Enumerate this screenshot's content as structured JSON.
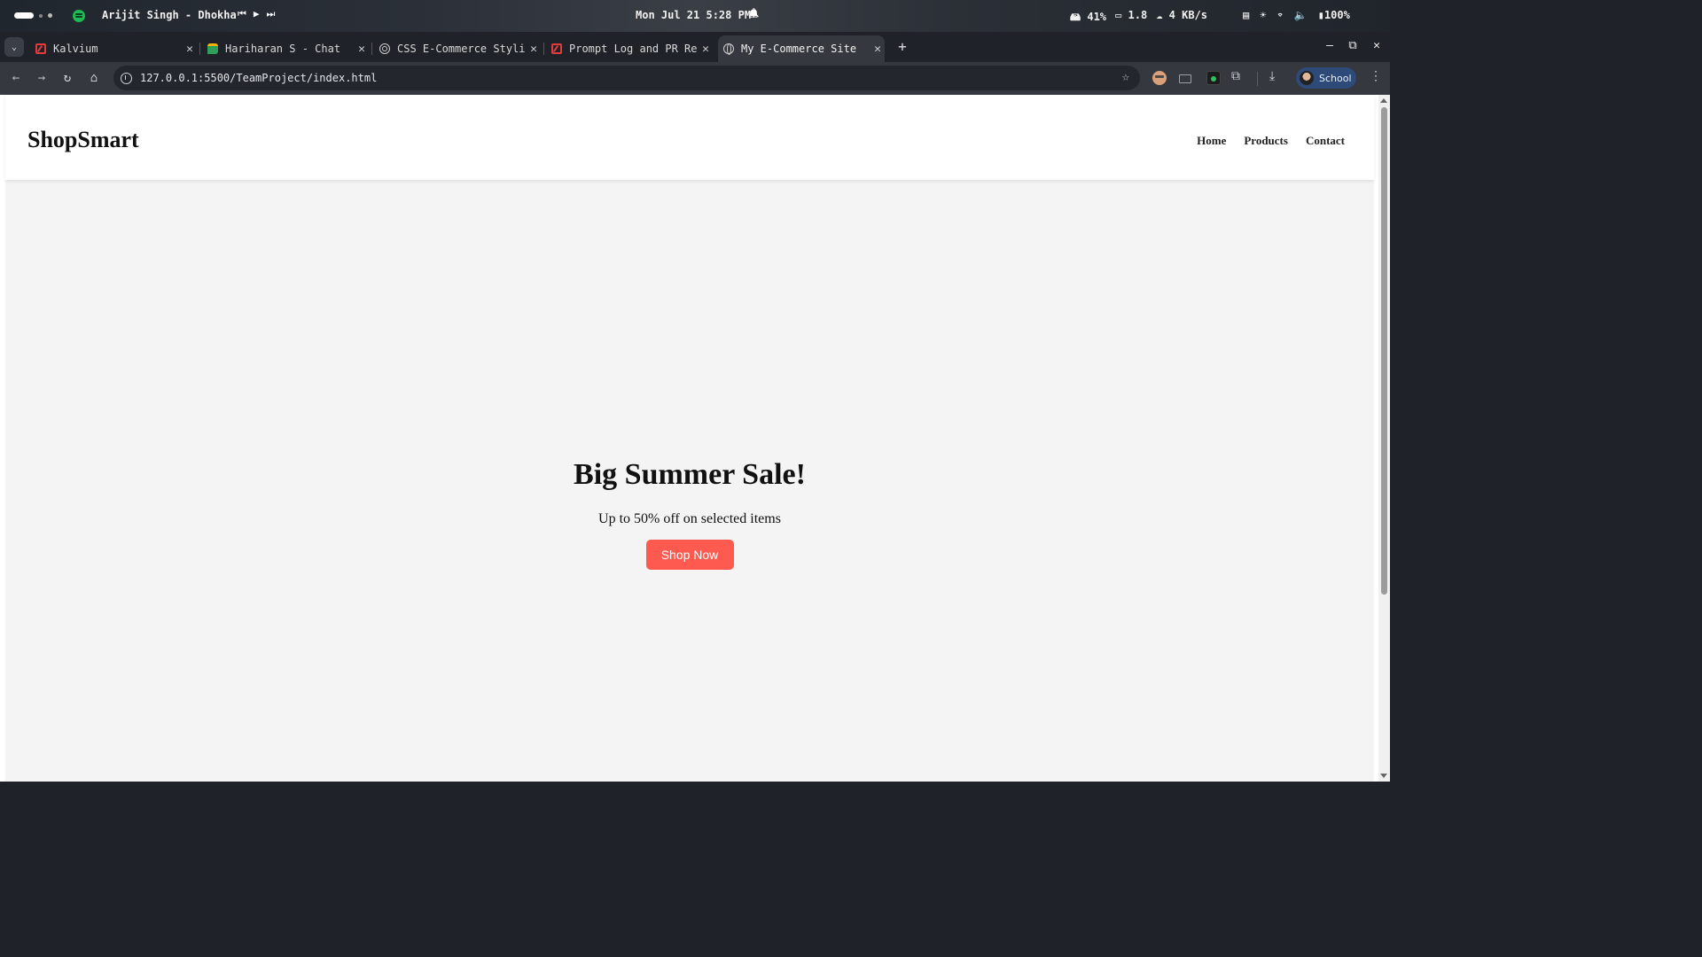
{
  "os": {
    "now_playing": "Arijit Singh - Dhokha",
    "media": {
      "prev": "⏮",
      "play": "▶",
      "next": "⏭"
    },
    "datetime": "Mon Jul 21   5:28 PM",
    "bell": "🔔",
    "stats": {
      "disk": "41%",
      "cpu": "1.8",
      "network": "4 KB/s"
    },
    "battery": "100%"
  },
  "tabs": [
    {
      "title": "Kalvium",
      "icon": "kalvium-icon"
    },
    {
      "title": "Hariharan S - Chat",
      "icon": "chat-icon"
    },
    {
      "title": "CSS E-Commerce Styli",
      "icon": "openai-icon"
    },
    {
      "title": "Prompt Log and PR Re",
      "icon": "kalvium-icon"
    },
    {
      "title": "My E-Commerce Site",
      "icon": "globe-icon",
      "active": true
    }
  ],
  "tab_close": "✕",
  "new_tab": "+",
  "window_controls": {
    "minimize": "–",
    "maximize": "⧉",
    "close": "✕"
  },
  "toolbar": {
    "back": "←",
    "forward": "→",
    "reload": "↻",
    "home": "⌂",
    "url": "127.0.0.1:5500/TeamProject/index.html",
    "bookmark": "☆",
    "download": "⤓",
    "profile_label": "School",
    "menu": "⋮"
  },
  "site": {
    "logo": "ShopSmart",
    "nav": [
      "Home",
      "Products",
      "Contact"
    ],
    "hero": {
      "title": "Big Summer Sale!",
      "subtitle": "Up to 50% off on selected items",
      "cta": "Shop Now"
    }
  },
  "colors": {
    "cta": "#ff5a4f",
    "page_bg": "#f4f4f4",
    "header_bg": "#ffffff"
  }
}
